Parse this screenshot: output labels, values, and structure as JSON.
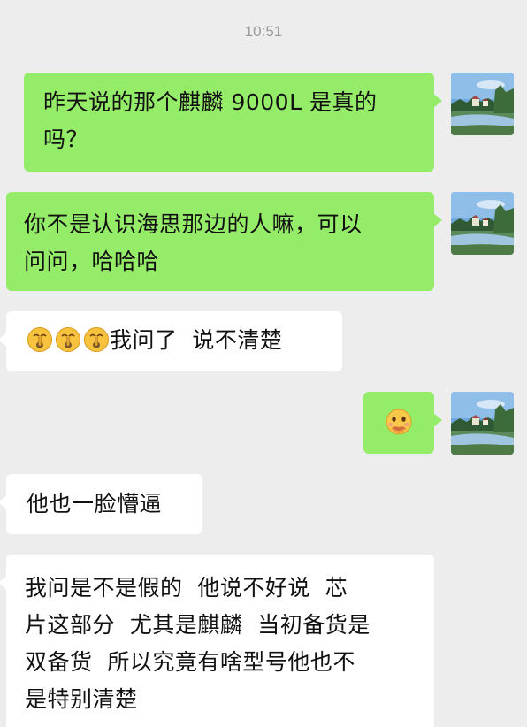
{
  "timestamp": "10:51",
  "messages": [
    {
      "from": "me",
      "text": "昨天说的那个麒麟 9000L 是真的吗？",
      "lines": [
        "昨天说的那个麒麟 9000L 是真的",
        "吗？"
      ]
    },
    {
      "from": "me",
      "text": "你不是认识海思那边的人嘛，可以问问，哈哈哈",
      "lines": [
        "你不是认识海思那边的人嘛，可以",
        "问问，哈哈哈"
      ]
    },
    {
      "from": "them",
      "emojis": [
        "emoji-shh",
        "emoji-shh",
        "emoji-shh"
      ],
      "text": "我问了  说不清楚"
    },
    {
      "from": "me",
      "emojis": [
        "emoji-face-with-hand"
      ]
    },
    {
      "from": "them",
      "text": "他也一脸懵逼"
    },
    {
      "from": "them",
      "text": "我问是不是假的  他说不好说  芯片这部分  尤其是麒麟  当初备货是双备货  所以究竟有啥型号他也不是特别清楚",
      "lines": [
        "我问是不是假的  他说不好说  芯",
        "片这部分  尤其是麒麟  当初备货是",
        "双备货  所以究竟有啥型号他也不",
        "是特别清楚"
      ]
    }
  ],
  "colors": {
    "background": "#ededed",
    "sent_bubble": "#95ec69",
    "received_bubble": "#ffffff",
    "timestamp": "#9b9b9b"
  }
}
